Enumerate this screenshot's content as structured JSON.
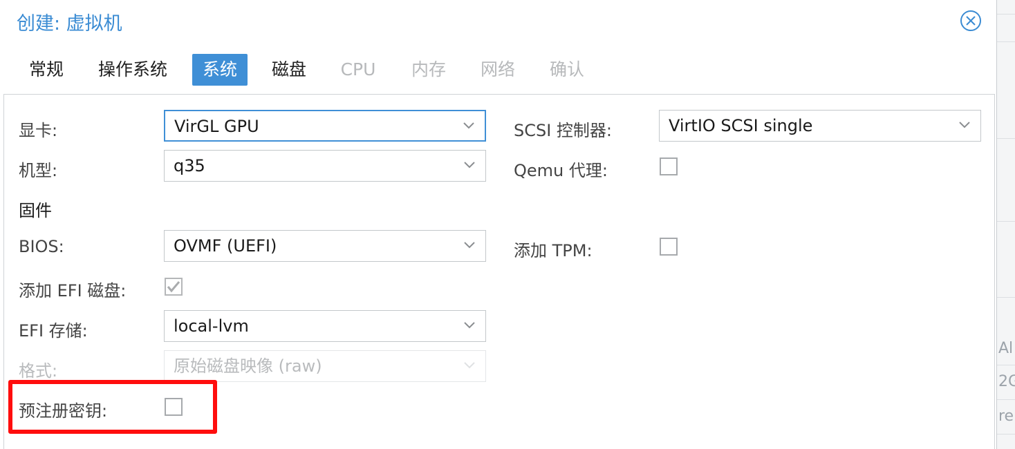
{
  "dialog": {
    "title": "创建: 虚拟机"
  },
  "tabs": [
    {
      "label": "常规",
      "state": "normal"
    },
    {
      "label": "操作系统",
      "state": "normal"
    },
    {
      "label": "系统",
      "state": "active"
    },
    {
      "label": "磁盘",
      "state": "normal"
    },
    {
      "label": "CPU",
      "state": "disabled"
    },
    {
      "label": "内存",
      "state": "disabled"
    },
    {
      "label": "网络",
      "state": "disabled"
    },
    {
      "label": "确认",
      "state": "disabled"
    }
  ],
  "form": {
    "graphics_card": {
      "label": "显卡:",
      "value": "VirGL GPU"
    },
    "machine": {
      "label": "机型:",
      "value": "q35"
    },
    "firmware_section": "固件",
    "bios": {
      "label": "BIOS:",
      "value": "OVMF (UEFI)"
    },
    "add_efi_disk": {
      "label": "添加 EFI 磁盘:",
      "checked": true
    },
    "efi_storage": {
      "label": "EFI 存储:",
      "value": "local-lvm"
    },
    "format": {
      "label": "格式:",
      "value": "原始磁盘映像 (raw)",
      "disabled": true
    },
    "pre_enrolled_keys": {
      "label": "预注册密钥:",
      "checked": false
    },
    "scsi_controller": {
      "label": "SCSI 控制器:",
      "value": "VirtIO SCSI single"
    },
    "qemu_agent": {
      "label": "Qemu 代理:",
      "checked": false
    },
    "add_tpm": {
      "label": "添加 TPM:",
      "checked": false
    }
  },
  "background_fragments": [
    "Al",
    "2G",
    "re"
  ],
  "colors": {
    "accent": "#3f8fd6",
    "title": "#3a8bd3",
    "highlight": "#ff0d0d"
  }
}
